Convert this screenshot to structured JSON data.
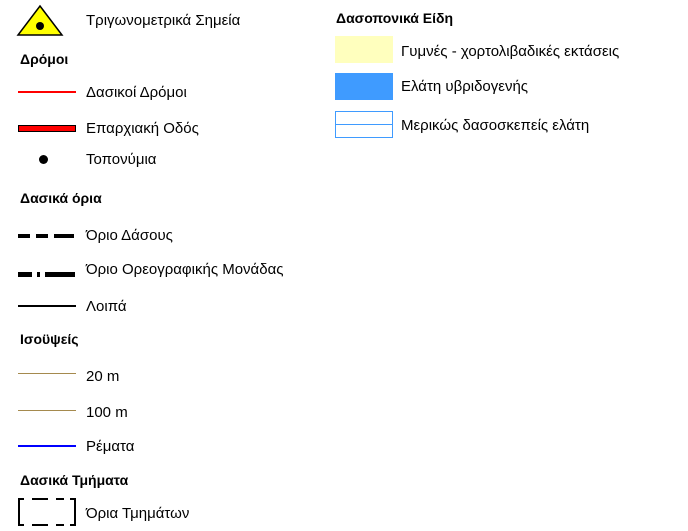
{
  "left_legend": {
    "trig_points": {
      "label": "Τριγωνομετρικά Σημεία",
      "icon": "triangle-point-icon",
      "fill": "#ffff00"
    },
    "roads": {
      "heading": "Δρόμοι",
      "items": [
        {
          "label": "Δασικοί Δρόμοι",
          "color": "#ff0000"
        },
        {
          "label": "Επαρχιακή Οδός",
          "color": "#ff0000"
        }
      ]
    },
    "toponyms": {
      "label": "Τοπονύμια",
      "icon": "dot-icon"
    },
    "forest_boundaries": {
      "heading": "Δασικά όρια",
      "items": [
        {
          "label": "Όριο Δάσους"
        },
        {
          "label": "Όριο Ορεογραφικής Μονάδας"
        },
        {
          "label": "Λοιπά"
        }
      ]
    },
    "contours": {
      "heading": "Ισοϋψείς",
      "items": [
        {
          "label": "20 m",
          "color": "#a58a4e"
        },
        {
          "label": "100 m",
          "color": "#a58a4e"
        },
        {
          "label": "Ρέματα",
          "color": "#0000ff"
        }
      ]
    },
    "forest_sections": {
      "heading": "Δασικά Τμήματα",
      "items": [
        {
          "label": "Όρια Τμημάτων"
        }
      ]
    }
  },
  "right_legend": {
    "heading": "Δασοπονικά Είδη",
    "items": [
      {
        "label": "Γυμνές - χορτολιβαδικές εκτάσεις",
        "fill": "#ffffbe"
      },
      {
        "label": "Ελάτη υβριδογενής",
        "fill": "#3f9bff"
      },
      {
        "label": "Μερικώς δασοσκεπείς ελάτη",
        "fill": "#ffffff",
        "stroke": "#3f9bff"
      }
    ]
  }
}
